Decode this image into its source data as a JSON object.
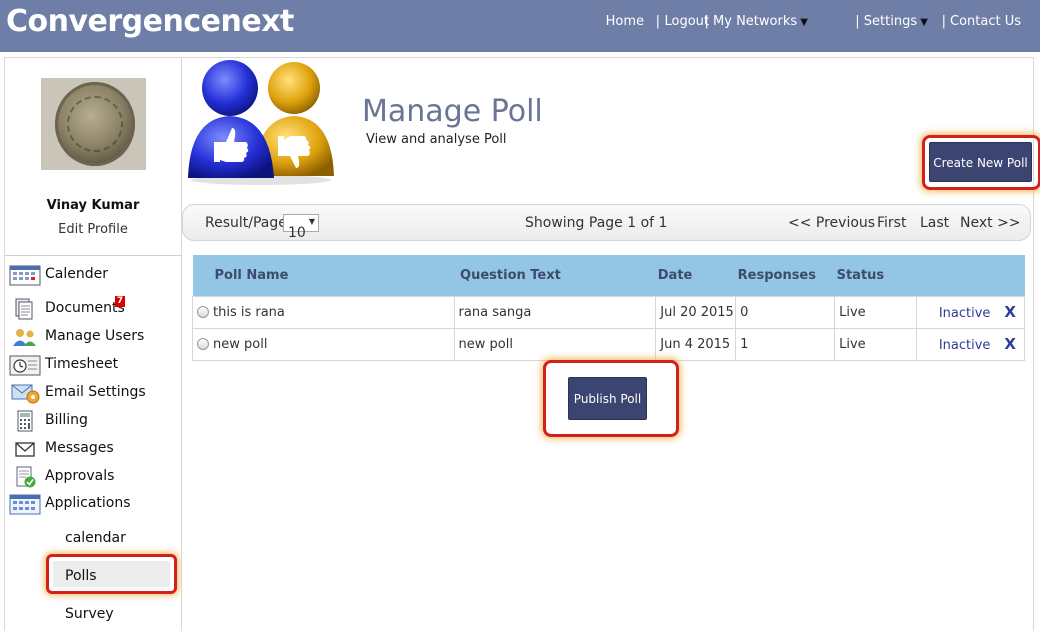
{
  "header": {
    "brand": "Convergencenext",
    "nav": {
      "home": "Home",
      "sep1": "|",
      "logout": "Logout",
      "my_networks": "| My Networks",
      "settings": "| Settings",
      "sep4": "|",
      "contact": "Contact Us"
    }
  },
  "sidebar": {
    "user_name": "Vinay Kumar",
    "edit_profile": "Edit Profile",
    "items": [
      {
        "label": "Calender",
        "icon": "calendar-icon"
      },
      {
        "label": "Documents",
        "icon": "documents-icon",
        "badge": "7"
      },
      {
        "label": "Manage Users",
        "icon": "users-icon"
      },
      {
        "label": "Timesheet",
        "icon": "timesheet-icon"
      },
      {
        "label": "Email Settings",
        "icon": "email-settings-icon"
      },
      {
        "label": "Billing",
        "icon": "billing-icon"
      },
      {
        "label": "Messages",
        "icon": "messages-icon"
      },
      {
        "label": "Approvals",
        "icon": "approvals-icon"
      },
      {
        "label": "Applications",
        "icon": "applications-icon"
      }
    ],
    "sub_items": {
      "calendar": "calendar",
      "polls": "Polls",
      "survey": "Survey"
    }
  },
  "main": {
    "title": "Manage Poll",
    "subtitle": "View and analyse Poll",
    "create_button": "Create New Poll",
    "pager": {
      "result_label": "Result/Page",
      "per_page": "10",
      "showing": "Showing Page 1 of 1",
      "previous": "<< Previous",
      "first": "First",
      "last": "Last",
      "next": "Next >>"
    },
    "table": {
      "headers": {
        "poll_name": "Poll Name",
        "question_text": "Question Text",
        "date": "Date",
        "responses": "Responses",
        "status": "Status"
      },
      "rows": [
        {
          "poll_name": "this is rana",
          "question": "rana sanga",
          "date": "Jul 20 2015",
          "responses": "0",
          "status": "Live",
          "action": "Inactive",
          "delete": "X"
        },
        {
          "poll_name": "new poll",
          "question": "new poll",
          "date": "Jun 4 2015",
          "responses": "1",
          "status": "Live",
          "action": "Inactive",
          "delete": "X"
        }
      ]
    },
    "publish_button": "Publish Poll"
  },
  "colors": {
    "header_bg": "#6e7ea6",
    "button_bg": "#3c4571",
    "table_header_bg": "#93c6e5",
    "highlight": "#d3201a",
    "title_color": "#6a7495"
  }
}
